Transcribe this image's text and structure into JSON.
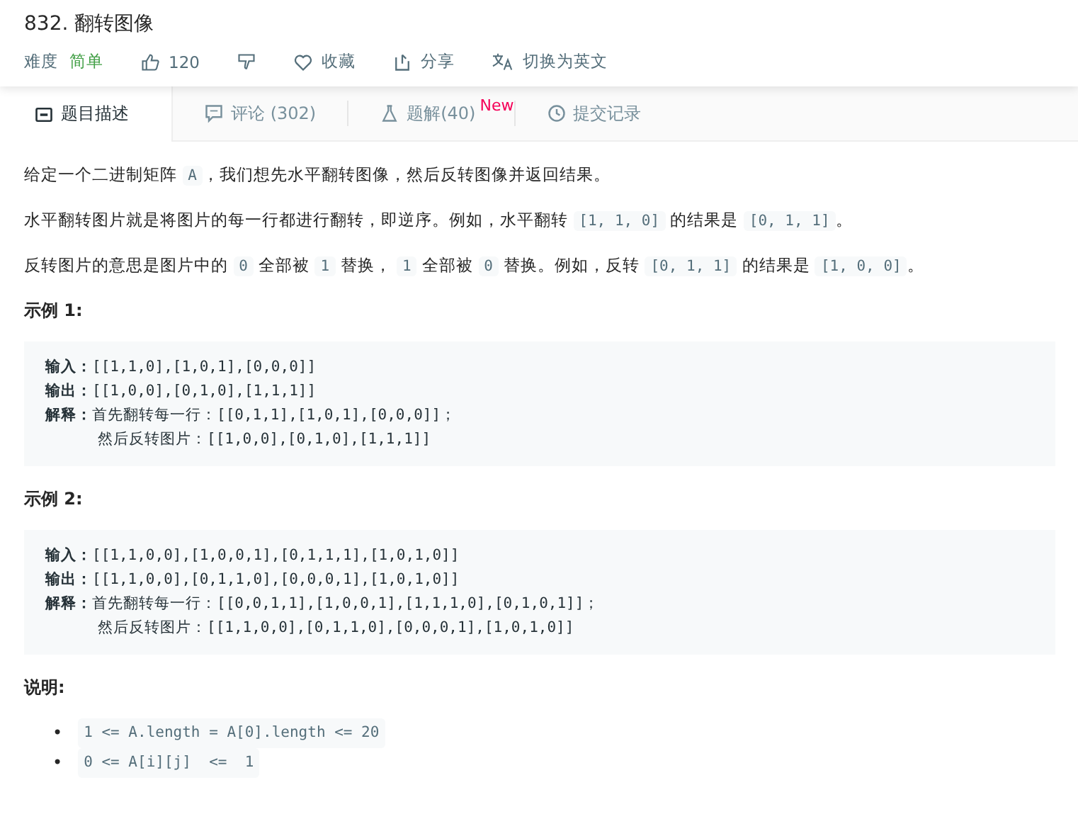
{
  "title": "832. 翻转图像",
  "meta": {
    "difficulty_label": "难度",
    "difficulty": "简单",
    "likes": "120",
    "favorite": "收藏",
    "share": "分享",
    "translate": "切换为英文"
  },
  "tabs": [
    {
      "label": "题目描述",
      "selected": true
    },
    {
      "label": "评论 (302)",
      "selected": false
    },
    {
      "label": "题解(40)",
      "selected": false,
      "badge": "New"
    },
    {
      "label": "提交记录",
      "selected": false
    }
  ],
  "paragraphs": [
    [
      {
        "text": "给定一个二进制矩阵 ",
        "code": false
      },
      {
        "text": "A",
        "code": true
      },
      {
        "text": "，我们想先水平翻转图像，然后反转图像并返回结果。",
        "code": false
      }
    ],
    [
      {
        "text": "水平翻转图片就是将图片的每一行都进行翻转，即逆序。例如，水平翻转 ",
        "code": false
      },
      {
        "text": "[1, 1, 0]",
        "code": true
      },
      {
        "text": " 的结果是 ",
        "code": false
      },
      {
        "text": "[0, 1, 1]",
        "code": true
      },
      {
        "text": "。",
        "code": false
      }
    ],
    [
      {
        "text": "反转图片的意思是图片中的 ",
        "code": false
      },
      {
        "text": "0",
        "code": true
      },
      {
        "text": " 全部被 ",
        "code": false
      },
      {
        "text": "1",
        "code": true
      },
      {
        "text": " 替换， ",
        "code": false
      },
      {
        "text": "1",
        "code": true
      },
      {
        "text": " 全部被 ",
        "code": false
      },
      {
        "text": "0",
        "code": true
      },
      {
        "text": " 替换。例如，反转 ",
        "code": false
      },
      {
        "text": "[0, 1, 1]",
        "code": true
      },
      {
        "text": " 的结果是 ",
        "code": false
      },
      {
        "text": "[1, 0, 0]",
        "code": true
      },
      {
        "text": "。",
        "code": false
      }
    ]
  ],
  "examples": [
    {
      "heading": "示例 1:",
      "lines": [
        {
          "text": "**输入：**[[1,1,0],[1,0,1],[0,0,0]]",
          "continued": false
        },
        {
          "text": "**输出：**[[1,0,0],[0,1,0],[1,1,1]]",
          "continued": false
        },
        {
          "text": "**解释：**首先翻转每一行：[[0,1,1],[1,0,1],[0,0,0]]；",
          "continued": false
        },
        {
          "text": "然后反转图片：[[1,0,0],[0,1,0],[1,1,1]]",
          "continued": true
        }
      ]
    },
    {
      "heading": "示例 2:",
      "lines": [
        {
          "text": "**输入：**[[1,1,0,0],[1,0,0,1],[0,1,1,1],[1,0,1,0]]",
          "continued": false
        },
        {
          "text": "**输出：**[[1,1,0,0],[0,1,1,0],[0,0,0,1],[1,0,1,0]]",
          "continued": false
        },
        {
          "text": "**解释：**首先翻转每一行：[[0,0,1,1],[1,0,0,1],[1,1,1,0],[0,1,0,1]]；",
          "continued": false
        },
        {
          "text": "然后反转图片：[[1,1,0,0],[0,1,1,0],[0,0,0,1],[1,0,1,0]]",
          "continued": true
        }
      ]
    }
  ],
  "notes_heading": "说明:",
  "notes": [
    {
      "bullet": "•",
      "text": "1 <= A.length = A[0].length <= 20"
    },
    {
      "bullet": "•",
      "text": "0 <= A[i][j]  <=  1"
    }
  ]
}
